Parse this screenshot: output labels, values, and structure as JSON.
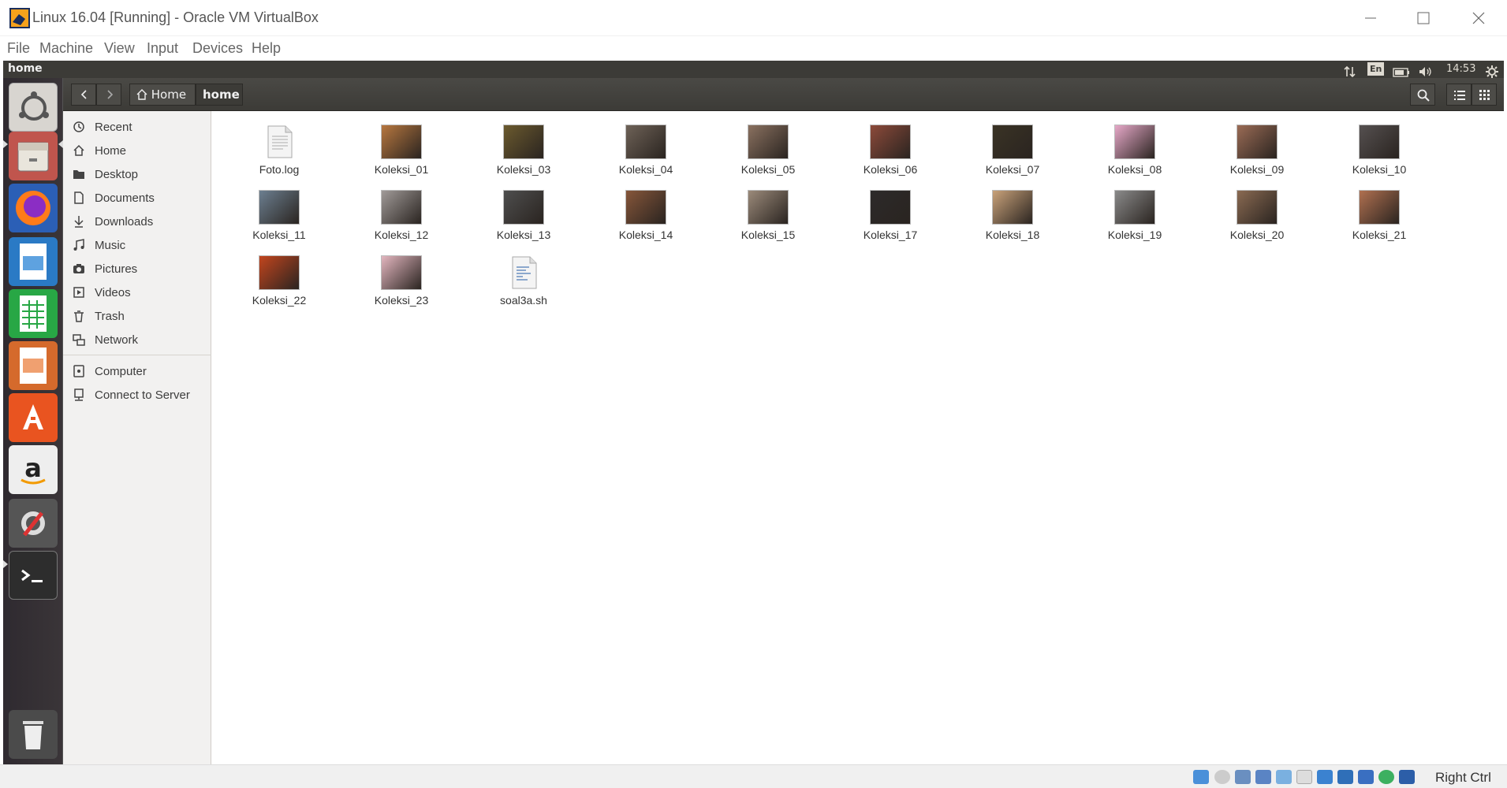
{
  "window": {
    "title": "Linux 16.04 [Running] - Oracle VM VirtualBox",
    "menu": [
      "File",
      "Machine",
      "View",
      "Input",
      "Devices",
      "Help"
    ]
  },
  "guest": {
    "panel_title": "home",
    "keyboard": "En",
    "clock": "14:53"
  },
  "launcher": {
    "icons": [
      "dash-icon",
      "files-icon",
      "firefox-icon",
      "writer-icon",
      "calc-icon",
      "impress-icon",
      "software-center-icon",
      "amazon-icon",
      "system-settings-icon",
      "terminal-icon",
      "trash-icon"
    ]
  },
  "header": {
    "breadcrumbs": [
      "Home",
      "home"
    ]
  },
  "sidebar": {
    "items": [
      {
        "label": "Recent",
        "icon": "clock-icon"
      },
      {
        "label": "Home",
        "icon": "home-icon"
      },
      {
        "label": "Desktop",
        "icon": "folder-icon"
      },
      {
        "label": "Documents",
        "icon": "document-icon"
      },
      {
        "label": "Downloads",
        "icon": "download-icon"
      },
      {
        "label": "Music",
        "icon": "music-icon"
      },
      {
        "label": "Pictures",
        "icon": "camera-icon"
      },
      {
        "label": "Videos",
        "icon": "video-icon"
      },
      {
        "label": "Trash",
        "icon": "trash-icon"
      },
      {
        "label": "Network",
        "icon": "network-icon"
      }
    ],
    "devices": [
      {
        "label": "Computer",
        "icon": "computer-icon"
      },
      {
        "label": "Connect to Server",
        "icon": "server-icon"
      }
    ]
  },
  "files": [
    {
      "name": "Foto.log",
      "kind": "text",
      "color": "#e8e8e8"
    },
    {
      "name": "Koleksi_01",
      "kind": "image",
      "color": "#b7773f"
    },
    {
      "name": "Koleksi_03",
      "kind": "image",
      "color": "#6b5a2e"
    },
    {
      "name": "Koleksi_04",
      "kind": "image",
      "color": "#6e6257"
    },
    {
      "name": "Koleksi_05",
      "kind": "image",
      "color": "#8a7160"
    },
    {
      "name": "Koleksi_06",
      "kind": "image",
      "color": "#8c4a3a"
    },
    {
      "name": "Koleksi_07",
      "kind": "image",
      "color": "#3a3325"
    },
    {
      "name": "Koleksi_08",
      "kind": "image",
      "color": "#e6a8c8"
    },
    {
      "name": "Koleksi_09",
      "kind": "image",
      "color": "#9a6b55"
    },
    {
      "name": "Koleksi_10",
      "kind": "image",
      "color": "#555050"
    },
    {
      "name": "Koleksi_11",
      "kind": "image",
      "color": "#6c7f90"
    },
    {
      "name": "Koleksi_12",
      "kind": "image",
      "color": "#a09a98"
    },
    {
      "name": "Koleksi_13",
      "kind": "image",
      "color": "#4e4e4e"
    },
    {
      "name": "Koleksi_14",
      "kind": "image",
      "color": "#86563a"
    },
    {
      "name": "Koleksi_15",
      "kind": "image",
      "color": "#9b8a7a"
    },
    {
      "name": "Koleksi_17",
      "kind": "image",
      "color": "#2c2a2a"
    },
    {
      "name": "Koleksi_18",
      "kind": "image",
      "color": "#c9a27a"
    },
    {
      "name": "Koleksi_19",
      "kind": "image",
      "color": "#8a8a8a"
    },
    {
      "name": "Koleksi_20",
      "kind": "image",
      "color": "#8a6a52"
    },
    {
      "name": "Koleksi_21",
      "kind": "image",
      "color": "#b07050"
    },
    {
      "name": "Koleksi_22",
      "kind": "image",
      "color": "#c2451e"
    },
    {
      "name": "Koleksi_23",
      "kind": "image",
      "color": "#e3b6bf"
    },
    {
      "name": "soal3a.sh",
      "kind": "script",
      "color": "#e8e8e8"
    }
  ],
  "statusbar": {
    "host_key": "Right Ctrl"
  }
}
